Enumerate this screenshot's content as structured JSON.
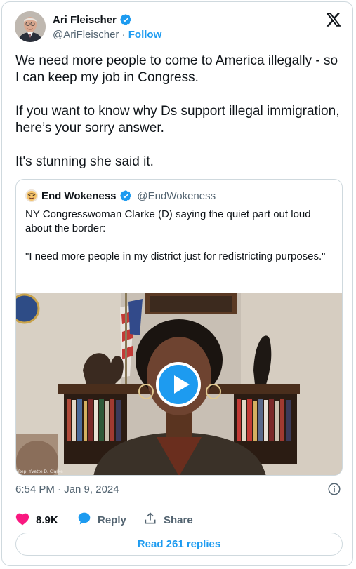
{
  "author": {
    "name": "Ari Fleischer",
    "handle": "@AriFleischer",
    "separator": " · ",
    "follow_label": "Follow",
    "verified": true
  },
  "tweet": {
    "paragraphs": [
      "We need more people to come to America illegally - so I can keep my job in Congress.",
      "If you want to know why Ds support illegal immigration, here’s your sorry answer.",
      "It's stunning she said it."
    ],
    "timestamp": "6:54 PM · Jan 9, 2024"
  },
  "quoted_tweet": {
    "name": "End Wokeness",
    "handle": "@EndWokeness",
    "verified": true,
    "paragraphs": [
      "NY Congresswoman Clarke (D) saying the quiet part out loud about the border:",
      "\"I need more people in my district just for redistricting purposes.\""
    ],
    "media": {
      "type": "video",
      "caption": "Rep. Yvette D. Clarke"
    }
  },
  "actions": {
    "likes": "8.9K",
    "reply_label": "Reply",
    "share_label": "Share",
    "read_replies_label": "Read 261 replies"
  },
  "icons": [
    "verified-badge-icon",
    "x-logo-icon",
    "play-icon",
    "info-icon",
    "heart-icon",
    "reply-bubble-icon",
    "share-icon"
  ],
  "colors": {
    "accent": "#1d9bf0",
    "like": "#f91880",
    "text": "#0f1419",
    "secondary_text": "#536471",
    "border": "#cfd9de"
  }
}
